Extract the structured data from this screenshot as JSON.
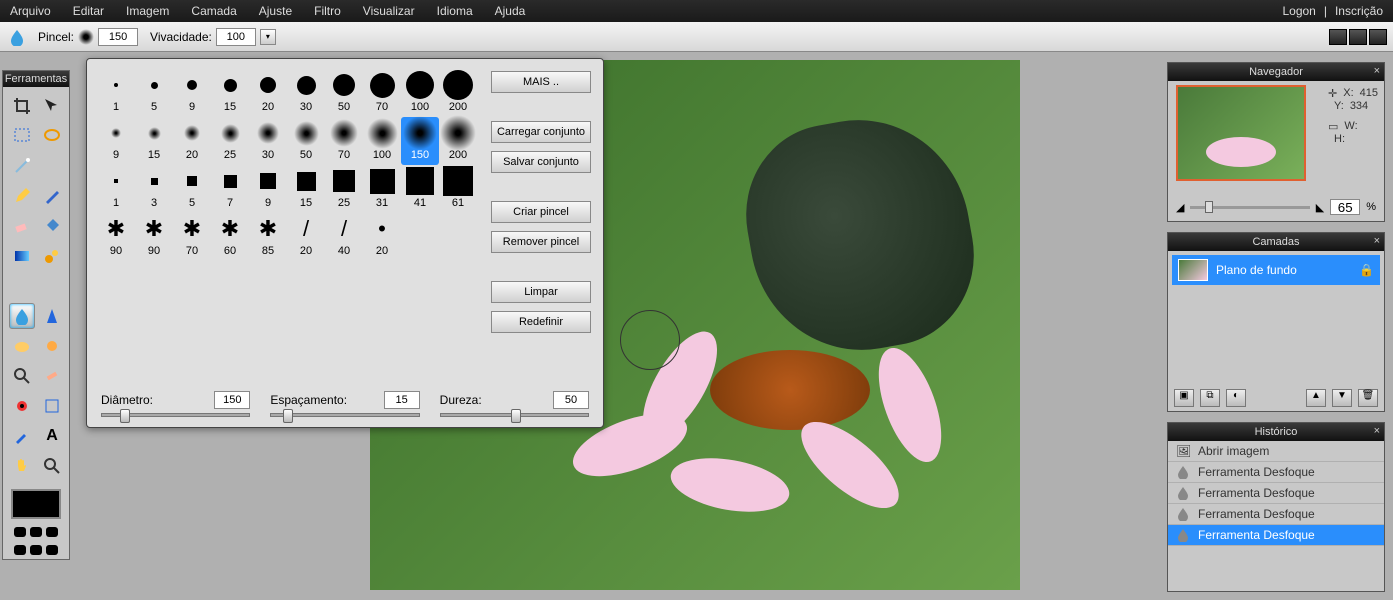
{
  "menu": {
    "items": [
      "Arquivo",
      "Editar",
      "Imagem",
      "Camada",
      "Ajuste",
      "Filtro",
      "Visualizar",
      "Idioma",
      "Ajuda"
    ],
    "right": [
      "Logon",
      "|",
      "Inscrição"
    ]
  },
  "optbar": {
    "brush_label": "Pincel:",
    "brush_value": "150",
    "vivacity_label": "Vivacidade:",
    "vivacity_value": "100"
  },
  "tools_panel": {
    "title": "Ferramentas"
  },
  "brush_popup": {
    "rows": [
      {
        "type": "hard",
        "sizes": [
          1,
          5,
          9,
          15,
          20,
          30,
          50,
          70,
          100,
          200
        ]
      },
      {
        "type": "soft",
        "sizes": [
          9,
          15,
          20,
          25,
          30,
          50,
          70,
          100,
          150,
          200
        ],
        "selected": 150
      },
      {
        "type": "square",
        "sizes": [
          1,
          3,
          5,
          7,
          9,
          15,
          25,
          31,
          41,
          61
        ]
      },
      {
        "type": "star",
        "sizes": [
          90,
          90,
          70,
          60,
          85,
          20,
          40,
          20
        ]
      }
    ],
    "buttons": {
      "more": "MAIS ..",
      "load": "Carregar conjunto",
      "save": "Salvar conjunto",
      "create": "Criar pincel",
      "remove": "Remover pincel",
      "clear": "Limpar",
      "reset": "Redefinir"
    },
    "sliders": {
      "diameter": {
        "label": "Diâmetro:",
        "value": "150"
      },
      "spacing": {
        "label": "Espaçamento:",
        "value": "15"
      },
      "hardness": {
        "label": "Dureza:",
        "value": "50"
      }
    }
  },
  "navigator": {
    "title": "Navegador",
    "x_label": "X:",
    "x": "415",
    "y_label": "Y:",
    "y": "334",
    "w_label": "W:",
    "w": "",
    "h_label": "H:",
    "h": "",
    "zoom": "65",
    "pct": "%"
  },
  "layers": {
    "title": "Camadas",
    "items": [
      {
        "name": "Plano de fundo",
        "locked": true
      }
    ]
  },
  "history": {
    "title": "Histórico",
    "items": [
      {
        "label": "Abrir imagem",
        "icon": "open"
      },
      {
        "label": "Ferramenta Desfoque",
        "icon": "blur"
      },
      {
        "label": "Ferramenta Desfoque",
        "icon": "blur"
      },
      {
        "label": "Ferramenta Desfoque",
        "icon": "blur"
      },
      {
        "label": "Ferramenta Desfoque",
        "icon": "blur",
        "selected": true
      }
    ]
  }
}
